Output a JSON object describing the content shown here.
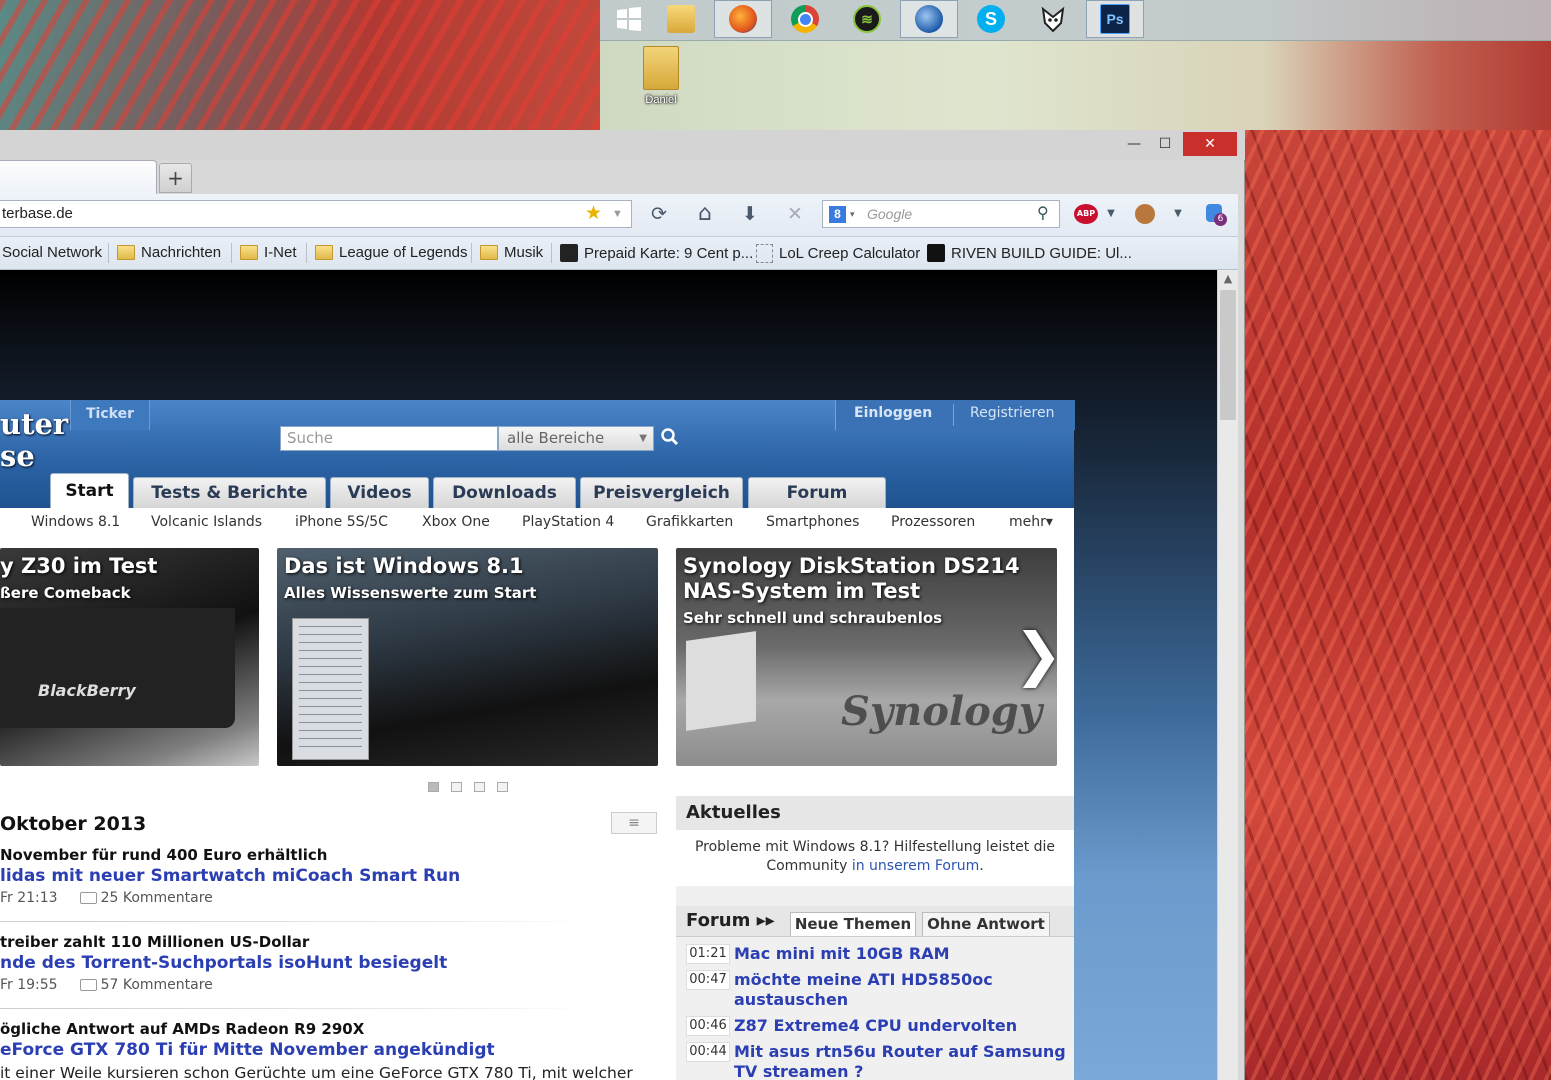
{
  "desktop": {
    "taskbar_icons": [
      "windows-start-icon",
      "file-explorer-icon",
      "firefox-icon",
      "chrome-icon",
      "spotify-icon",
      "thunderbird-icon",
      "skype-icon",
      "foobar-icon",
      "photoshop-icon"
    ],
    "photoshop_label": "Ps",
    "skype_label": "S",
    "folder_label": "Daniel"
  },
  "browser": {
    "window_controls": {
      "minimize": "—",
      "maximize": "☐",
      "close": "✕"
    },
    "new_tab_label": "+",
    "url": "terbase.de",
    "search_engine": "Google",
    "search_badge": "8",
    "toolbar": {
      "reload": "⟳",
      "home": "⌂",
      "download": "⬇",
      "stop": "✕",
      "abp": "ABP",
      "badge_count": "6"
    },
    "bookmarks": [
      {
        "label": "Social Network",
        "icon": "folder-icon"
      },
      {
        "label": "Nachrichten",
        "icon": "folder-icon"
      },
      {
        "label": "I-Net",
        "icon": "folder-icon"
      },
      {
        "label": "League of Legends",
        "icon": "folder-icon"
      },
      {
        "label": "Musik",
        "icon": "folder-icon"
      },
      {
        "label": "Prepaid Karte: 9 Cent p...",
        "icon": "site-icon"
      },
      {
        "label": "LoL Creep Calculator",
        "icon": "page-icon"
      },
      {
        "label": "RIVEN BUILD GUIDE: Ul...",
        "icon": "site-icon"
      }
    ]
  },
  "site": {
    "logo_line1": "uter",
    "logo_line2": "se",
    "ticker": "Ticker",
    "search_placeholder": "Suche",
    "search_scope": "alle Bereiche",
    "login": "Einloggen",
    "register": "Registrieren",
    "main_tabs": [
      "Start",
      "Tests & Berichte",
      "Videos",
      "Downloads",
      "Preisvergleich",
      "Forum"
    ],
    "sub_nav": [
      "Windows 8.1",
      "Volcanic Islands",
      "iPhone 5S/5C",
      "Xbox One",
      "PlayStation 4",
      "Grafikkarten",
      "Smartphones",
      "Prozessoren",
      "mehr▾"
    ],
    "slides": [
      {
        "title": "y Z30 im Test",
        "subtitle": "ßere Comeback",
        "brand": "BlackBerry"
      },
      {
        "title": "Das ist Windows 8.1",
        "subtitle": "Alles Wissenswerte zum Start"
      },
      {
        "title": "Synology DiskStation DS214",
        "title2": "NAS-System im Test",
        "subtitle": "Sehr schnell und schraubenlos",
        "brand": "Synology",
        "next": "❯"
      }
    ],
    "news": {
      "date_heading": "Oktober 2013",
      "view_toggle": "≡",
      "items": [
        {
          "kicker": "November für rund 400 Euro erhältlich",
          "headline": "lidas mit neuer Smartwatch miCoach Smart Run",
          "time": "Fr 21:13",
          "comments": "25 Kommentare"
        },
        {
          "kicker": "treiber zahlt 110 Millionen US-Dollar",
          "headline": "nde des Torrent-Suchportals isoHunt besiegelt",
          "time": "Fr 19:55",
          "comments": "57 Kommentare"
        },
        {
          "kicker": "ögliche Antwort auf AMDs Radeon R9 290X",
          "headline": "eForce GTX 780 Ti für Mitte November angekündigt",
          "snippet": "it einer Weile kursieren schon Gerüchte um eine GeForce GTX 780 Ti, mit welcher"
        }
      ]
    },
    "aktuelles": {
      "title": "Aktuelles",
      "text": "Probleme mit Windows 8.1? Hilfestellung leistet die",
      "text2": "Community ",
      "link": "in unserem Forum",
      "text3": "."
    },
    "forum": {
      "title": "Forum ▸▸",
      "tabs": [
        "Neue Themen",
        "Ohne Antwort"
      ],
      "threads": [
        {
          "time": "01:21",
          "title": "Mac mini mit 10GB RAM"
        },
        {
          "time": "00:47",
          "title": "möchte meine ATI HD5850oc austauschen"
        },
        {
          "time": "00:46",
          "title": "Z87 Extreme4 CPU undervolten"
        },
        {
          "time": "00:44",
          "title": "Mit asus rtn56u Router auf Samsung TV streamen ?"
        }
      ]
    }
  }
}
